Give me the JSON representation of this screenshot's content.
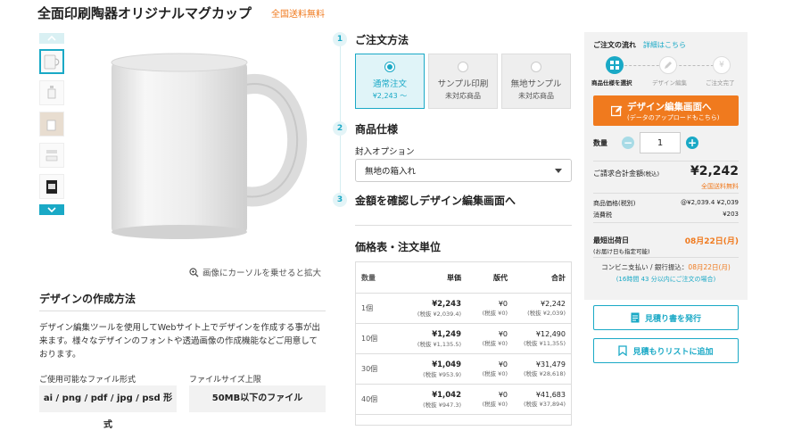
{
  "product": {
    "title": "全面印刷陶器オリジナルマグカップ",
    "free_shipping": "全国送料無料"
  },
  "gallery": {
    "zoom_hint": "画像にカーソルを乗せると拡大"
  },
  "design_section": {
    "heading": "デザインの作成方法",
    "description": "デザイン編集ツールを使用してWebサイト上でデザインを作成する事が出来ます。様々なデザインのフォントや透過画像の作成機能などご用意しております。",
    "file_types_label": "ご使用可能なファイル形式",
    "file_types_value": "ai / png / pdf / jpg / psd 形式",
    "file_size_label": "ファイルサイズ上限",
    "file_size_value": "50MB以下のファイル"
  },
  "steps": [
    {
      "num": "1",
      "title": "ご注文方法"
    },
    {
      "num": "2",
      "title": "商品仕様"
    },
    {
      "num": "3",
      "title": "金額を確認しデザイン編集画面へ"
    }
  ],
  "order_options": [
    {
      "label": "通常注文",
      "sub": "¥2,243 〜",
      "selected": true
    },
    {
      "label": "サンプル印刷",
      "sub": "未対応商品",
      "selected": false
    },
    {
      "label": "無地サンプル",
      "sub": "未対応商品",
      "selected": false
    }
  ],
  "spec": {
    "label": "封入オプション",
    "selected_value": "無地の箱入れ"
  },
  "price_table": {
    "heading": "価格表・注文単位",
    "headers": [
      "数量",
      "単価",
      "版代",
      "合計"
    ],
    "rows": [
      {
        "qty": "1個",
        "unit": "¥2,243",
        "unit_tax": "(税抜 ¥2,039.4)",
        "plate": "¥0",
        "plate_tax": "(税抜 ¥0)",
        "total": "¥2,242",
        "total_tax": "(税抜 ¥2,039)"
      },
      {
        "qty": "10個",
        "unit": "¥1,249",
        "unit_tax": "(税抜 ¥1,135.5)",
        "plate": "¥0",
        "plate_tax": "(税抜 ¥0)",
        "total": "¥12,490",
        "total_tax": "(税抜 ¥11,355)"
      },
      {
        "qty": "30個",
        "unit": "¥1,049",
        "unit_tax": "(税抜 ¥953.9)",
        "plate": "¥0",
        "plate_tax": "(税抜 ¥0)",
        "total": "¥31,479",
        "total_tax": "(税抜 ¥28,618)"
      },
      {
        "qty": "40個",
        "unit": "¥1,042",
        "unit_tax": "(税抜 ¥947.3)",
        "plate": "¥0",
        "plate_tax": "(税抜 ¥0)",
        "total": "¥41,683",
        "total_tax": "(税抜 ¥37,894)"
      }
    ]
  },
  "order_panel": {
    "flow_label": "ご注文の流れ",
    "flow_link": "詳細はこちら",
    "flow_steps": [
      "商品仕様を選択",
      "デザイン編集",
      "ご注文完了"
    ],
    "edit_button": "デザイン編集画面へ",
    "edit_button_sub": "(データのアップロードもこちら)",
    "qty_label": "数量",
    "qty_value": "1",
    "total_label": "ご請求合計金額",
    "total_label_sub": "(税込)",
    "total_value": "¥2,242",
    "total_free": "全国送料無料",
    "item_price_label": "商品価格(税別)",
    "item_price_value": "@¥2,039.4 ¥2,039",
    "tax_label": "消費税",
    "tax_value": "¥203",
    "ship_label": "最短出荷日",
    "ship_label_sub": "(お届け日も指定可能)",
    "ship_value": "08月22日(月)",
    "conv_label": "コンビニ支払い / 銀行振込：",
    "conv_date": "08月22日(月)",
    "deadline": "(16時間 43 分以内にご注文の場合)",
    "colors": {
      "accent": "#1aa9c6",
      "orange": "#f07a1e"
    }
  },
  "buttons": {
    "quote": "見積り書を発行",
    "quote_list": "見積もりリストに追加"
  }
}
